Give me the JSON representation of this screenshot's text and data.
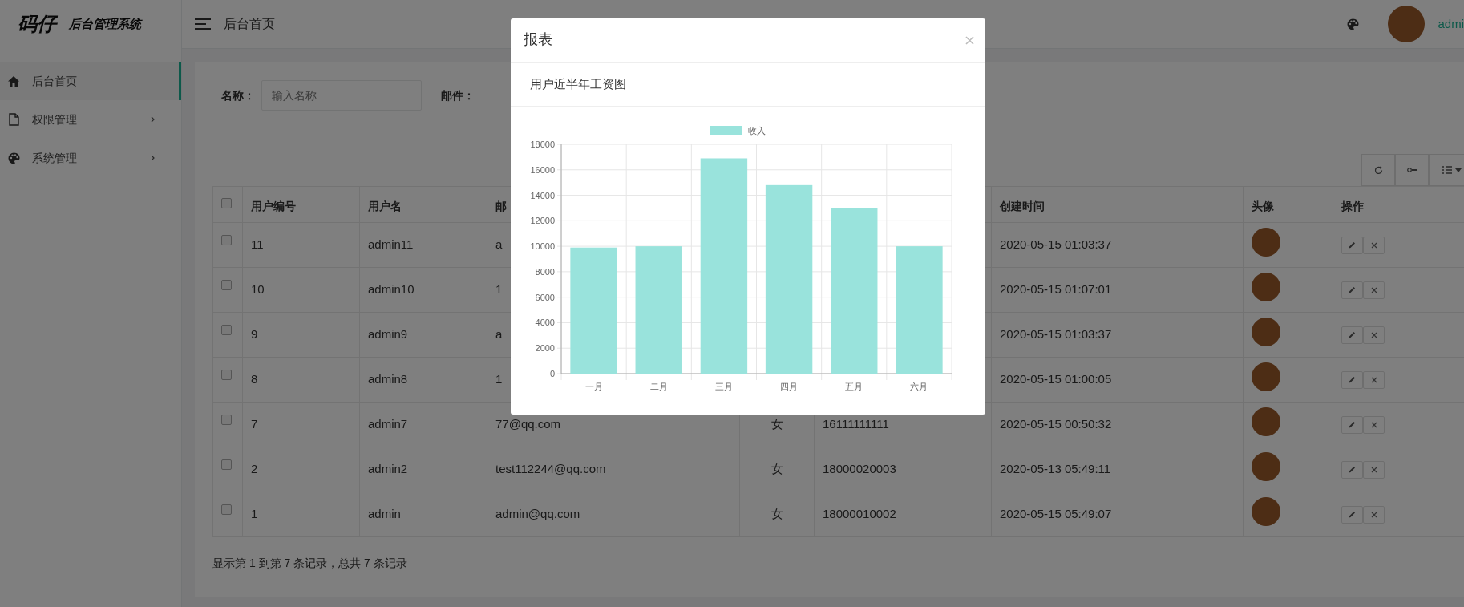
{
  "sidebar": {
    "logo": {
      "title": "码仔",
      "subtitle": "后台管理系统"
    },
    "items": [
      {
        "label": "后台首页",
        "kind": "home",
        "selected": true,
        "has_submenu": false
      },
      {
        "label": "权限管理",
        "kind": "file",
        "selected": false,
        "has_submenu": true
      },
      {
        "label": "系统管理",
        "kind": "palette",
        "selected": false,
        "has_submenu": true
      }
    ]
  },
  "header": {
    "title": "后台首页",
    "username": "admi"
  },
  "filters": [
    {
      "label": "名称：",
      "placeholder": "输入名称"
    },
    {
      "label": "邮件："
    }
  ],
  "table": {
    "header_checked": false,
    "columns": {
      "id": "用户编号",
      "username": "用户名",
      "email": "邮",
      "created": "创建时间",
      "avatar": "头像",
      "actions": "操作"
    },
    "rows": [
      {
        "checked": false,
        "id": "11",
        "username": "admin11",
        "email": "a",
        "created": "2020-05-15 01:03:37"
      },
      {
        "checked": false,
        "id": "10",
        "username": "admin10",
        "email": "1",
        "created": "2020-05-15 01:07:01"
      },
      {
        "checked": false,
        "id": "9",
        "username": "admin9",
        "email": "a",
        "created": "2020-05-15 01:03:37"
      },
      {
        "checked": false,
        "id": "8",
        "username": "admin8",
        "email": "1",
        "created": "2020-05-15 01:00:05"
      },
      {
        "checked": false,
        "id": "7",
        "username": "admin7",
        "email": "77@qq.com",
        "gender": "女",
        "phone": "16111111111",
        "created": "2020-05-15 00:50:32"
      },
      {
        "checked": false,
        "id": "2",
        "username": "admin2",
        "email": "test112244@qq.com",
        "gender": "女",
        "phone": "18000020003",
        "created": "2020-05-13 05:49:11"
      },
      {
        "checked": false,
        "id": "1",
        "username": "admin",
        "email": "admin@qq.com",
        "gender": "女",
        "phone": "18000010002",
        "created": "2020-05-15 05:49:07"
      }
    ],
    "pagination": "显示第 1 到第 7 条记录，总共 7 条记录"
  },
  "modal": {
    "title": "报表",
    "subtitle": "用户近半年工资图",
    "chart_data": {
      "type": "bar",
      "categories": [
        "一月",
        "二月",
        "三月",
        "四月",
        "五月",
        "六月"
      ],
      "series": [
        {
          "name": "收入",
          "color": "#99e3dc",
          "values": [
            9900,
            10000,
            16900,
            14800,
            13000,
            10000
          ]
        }
      ],
      "grid": true,
      "ylim": [
        0,
        18000
      ],
      "yticks": [
        0,
        2000,
        4000,
        6000,
        8000,
        10000,
        12000,
        14000,
        16000,
        18000
      ]
    }
  }
}
